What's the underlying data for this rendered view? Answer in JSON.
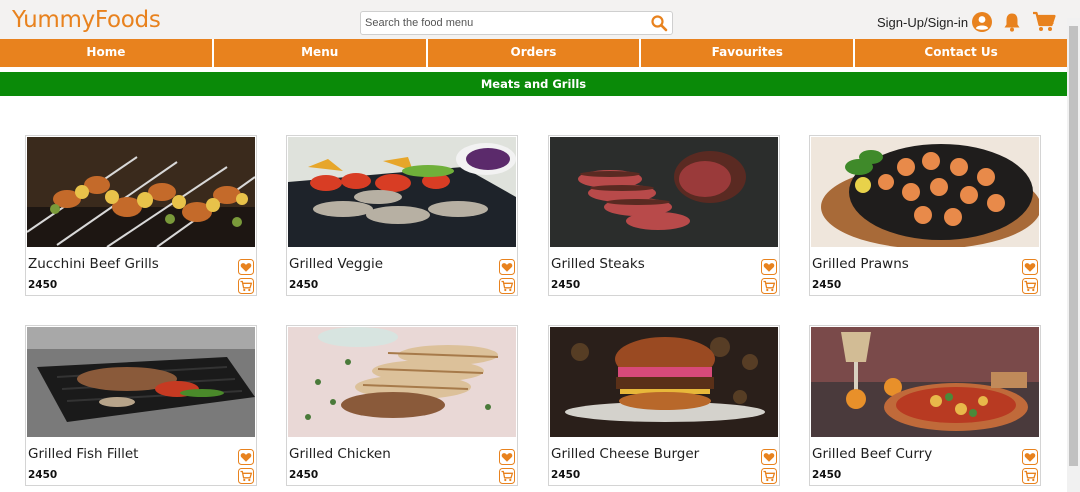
{
  "header": {
    "brand": "YummyFoods",
    "search_placeholder": "Search the food menu",
    "signin_label": "Sign-Up/Sign-in"
  },
  "nav": {
    "items": [
      "Home",
      "Menu",
      "Orders",
      "Favourites",
      "Contact Us"
    ]
  },
  "category": {
    "title": "Meats and Grills"
  },
  "products": [
    {
      "name": "Zucchini Beef Grills",
      "price": "2450"
    },
    {
      "name": "Grilled Veggie",
      "price": "2450"
    },
    {
      "name": "Grilled Steaks",
      "price": "2450"
    },
    {
      "name": "Grilled Prawns",
      "price": "2450"
    },
    {
      "name": "Grilled Fish Fillet",
      "price": "2450"
    },
    {
      "name": "Grilled Chicken",
      "price": "2450"
    },
    {
      "name": "Grilled Cheese Burger",
      "price": "2450"
    },
    {
      "name": "Grilled Beef Curry",
      "price": "2450"
    }
  ],
  "colors": {
    "brand_orange": "#e8821e",
    "category_green": "#0a8a08"
  },
  "icons": {
    "search": "search-icon",
    "user": "user-icon",
    "bell": "bell-icon",
    "cart": "cart-icon",
    "favourite": "heart-icon"
  }
}
